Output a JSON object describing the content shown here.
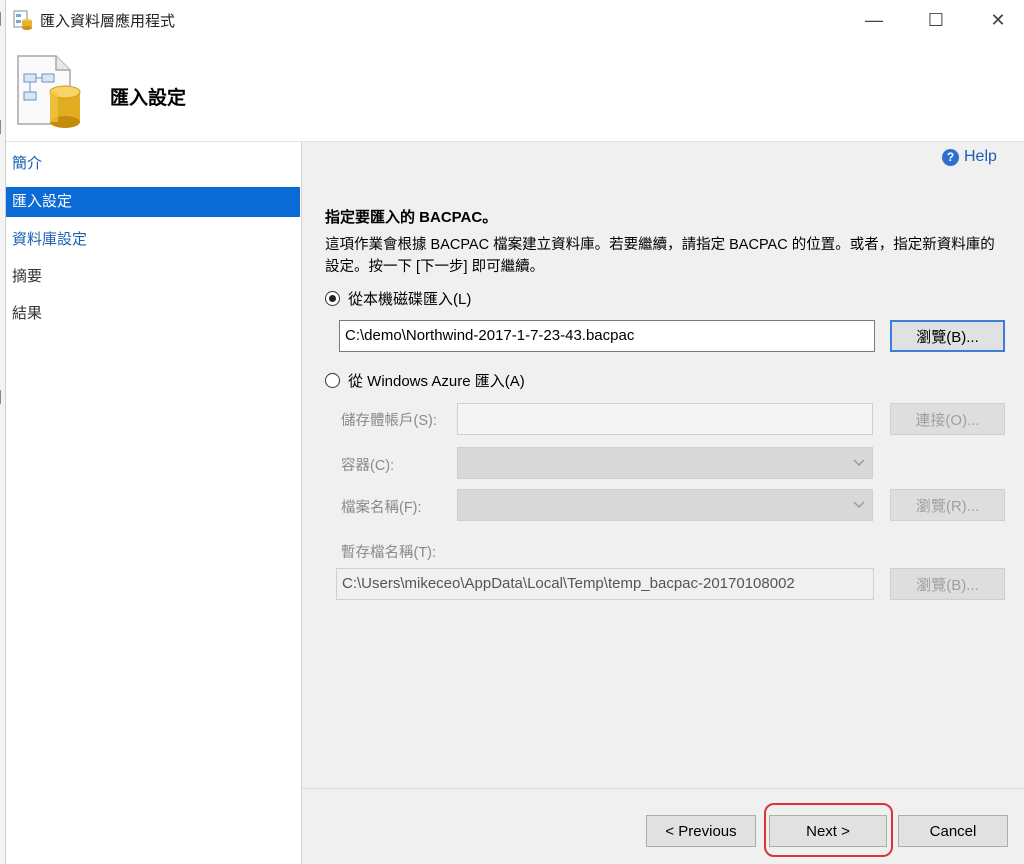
{
  "window": {
    "title": "匯入資料層應用程式",
    "minimize_glyph": "—",
    "maximize_glyph": "☐",
    "close_glyph": "✕"
  },
  "header": {
    "title": "匯入設定"
  },
  "nav": {
    "items": [
      {
        "label": "簡介",
        "state": "link"
      },
      {
        "label": "匯入設定",
        "state": "active"
      },
      {
        "label": "資料庫設定",
        "state": "link"
      },
      {
        "label": "摘要",
        "state": "plain"
      },
      {
        "label": "結果",
        "state": "plain"
      }
    ]
  },
  "help": {
    "label": "Help",
    "icon_glyph": "?"
  },
  "main": {
    "section_title": "指定要匯入的 BACPAC。",
    "description": "這項作業會根據 BACPAC 檔案建立資料庫。若要繼續，請指定 BACPAC 的位置。或者，指定新資料庫的設定。按一下 [下一步] 即可繼續。",
    "local": {
      "radio_label": "從本機磁碟匯入(L)",
      "selected": true,
      "path_value": "C:\\demo\\Northwind-2017-1-7-23-43.bacpac",
      "browse_label": "瀏覽(B)..."
    },
    "azure": {
      "radio_label": "從 Windows Azure 匯入(A)",
      "selected": false,
      "storage_label": "儲存體帳戶(S):",
      "connect_label": "連接(O)...",
      "container_label": "容器(C):",
      "filename_label": "檔案名稱(F):",
      "browse_r_label": "瀏覽(R)...",
      "temp_label": "暫存檔名稱(T):",
      "temp_value": "C:\\Users\\mikeceo\\AppData\\Local\\Temp\\temp_bacpac-20170108002",
      "browse_b_label": "瀏覽(B)..."
    }
  },
  "footer": {
    "previous_label": "< Previous",
    "next_label": "Next >",
    "cancel_label": "Cancel"
  },
  "colors": {
    "accent": "#0a6ad6",
    "link": "#1a5fb4",
    "highlight": "#d9343b"
  }
}
